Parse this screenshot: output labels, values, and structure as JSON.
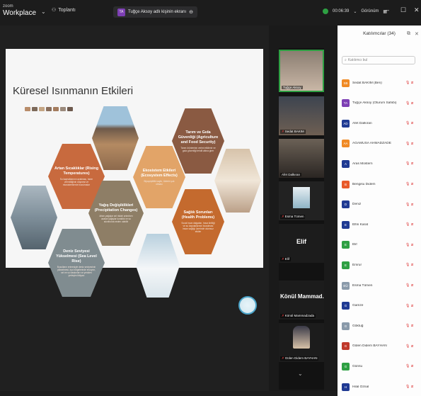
{
  "app": {
    "logo_small": "zoom",
    "logo_big": "Workplace",
    "menu_label": "Toplantı"
  },
  "meeting": {
    "pill_avatar": "TA",
    "pill_text": "Tuğçe Aksoy adlı kişinin ekranı"
  },
  "status": {
    "timer": "00:06:39",
    "view": "Görünüm"
  },
  "window": {
    "min": "–",
    "max": "☐",
    "close": "✕"
  },
  "slide": {
    "title": "Küresel Isınmanın Etkileri",
    "hexes": [
      {
        "title": "Artan Sıcaklıklar (Rising Temperatures)",
        "desc": "Su kaynaklarının azalması, tarım verimliliğinin düşmesi ve ekosistemlerde bozulmalar"
      },
      {
        "title": "Yağış Değişiklikleri (Precipitation Changes)",
        "desc": "Artan yağışlar sel riskini artırırken azalan yağışlar kuraklık ve su sıkıntısına neden olabilir"
      },
      {
        "title": "Ekosistem Etkileri (Ecosystem Effects)",
        "desc": "Biyoçeşitlilik kaybı, türlerin yok olması"
      },
      {
        "title": "Tarım ve Gıda Güvenliği (Agriculture and Food Security)",
        "desc": "Tarım ürünlerinin verimi etkilenir ve gıda güvenliği tehdit altına girer"
      },
      {
        "title": "Sağlık Sorunları (Health Problems)",
        "desc": "Sıcak hava dalgaları, hava kirliliği ve su kaynaklarının bozulması insan sağlığı üzerinde olumsuz etkiler"
      },
      {
        "title": "Deniz Seviyesi Yükselmesi (Sea Level Rise)",
        "desc": "Buzulların erimesiyle deniz seviyesinin yükselmesi, kıyı bölgelerinde erozyon, sel ve su baskınları ve yeniden yerleşim ihtiyacı"
      }
    ]
  },
  "videos": [
    {
      "name": "Tuğçe Aksoy",
      "muted": false
    },
    {
      "name": "Sedat BAKIM",
      "muted": true
    },
    {
      "name": "Afet Dalkıran",
      "muted": false
    },
    {
      "name": "Esma Tümen",
      "muted": true
    },
    {
      "name": "Elif",
      "big": "Elif",
      "muted": true
    },
    {
      "name": "Könül Mammadzada",
      "big": "Könül Mammad...",
      "muted": true
    },
    {
      "name": "Gülen Didem BAYHAN",
      "muted": true
    }
  ],
  "panel": {
    "title": "Katılımcılar (34)",
    "search_placeholder": "Katılımcı bul",
    "participants": [
      {
        "initials": "SB",
        "name": "Sedat BAKIM (Ben)",
        "color": "#f08a24"
      },
      {
        "initials": "TA",
        "name": "Tuğçe Aksoy (Oturum Sahibi)",
        "color": "#7d3fb4"
      },
      {
        "initials": "AD",
        "name": "Afet Dalkıran",
        "color": "#1f3a93"
      },
      {
        "initials": "AA",
        "name": "AGAMUSA AHMADZADE",
        "color": "#f08a24"
      },
      {
        "initials": "A",
        "name": "Aras Mostern",
        "color": "#1f3a93"
      },
      {
        "initials": "B",
        "name": "Bengisu Didem",
        "color": "#e85a2a"
      },
      {
        "initials": "D",
        "name": "Deniz",
        "color": "#1f3a93"
      },
      {
        "initials": "E",
        "name": "Elfin Karat",
        "color": "#1f3a93"
      },
      {
        "initials": "E",
        "name": "Elif",
        "color": "#2ea043"
      },
      {
        "initials": "E",
        "name": "Emrur",
        "color": "#2ea043"
      },
      {
        "initials": "EÜ",
        "name": "Esma Tümen",
        "color": "#8a9aaa"
      },
      {
        "initials": "G",
        "name": "Gamze",
        "color": "#1f3a93"
      },
      {
        "initials": "G",
        "name": "Göktuğ",
        "color": "#8a9aaa"
      },
      {
        "initials": "G",
        "name": "Gülen Didem BAYHAN",
        "color": "#c0392b"
      },
      {
        "initials": "G",
        "name": "Günsu",
        "color": "#2ea043"
      },
      {
        "initials": "H",
        "name": "Hilal Öznal",
        "color": "#1f3a93"
      }
    ]
  }
}
